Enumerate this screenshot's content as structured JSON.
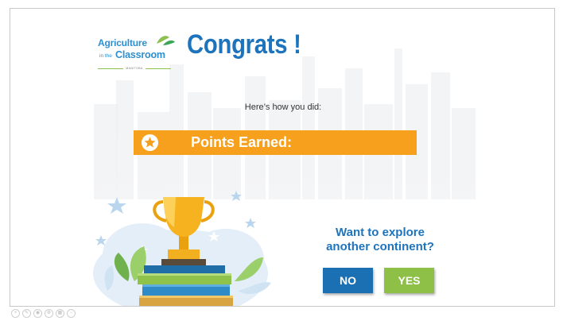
{
  "logo": {
    "line1": "Agriculture",
    "line2_prefix": "in the",
    "line2": "Classroom",
    "line3": "MANITOBA"
  },
  "title": "Congrats !",
  "subtitle": "Here’s how you did:",
  "banner": {
    "icon": "star-icon",
    "label": "Points Earned:"
  },
  "question": {
    "line1": "Want to explore",
    "line2": "another continent?"
  },
  "buttons": {
    "no": "NO",
    "yes": "YES"
  },
  "toolbar_icons": [
    "plus-icon",
    "edit-icon",
    "eye-icon",
    "settings-icon",
    "grid-icon",
    "minus-icon"
  ],
  "colors": {
    "title_blue": "#1d74bd",
    "banner_orange": "#f6a01d",
    "no_blue": "#1b6fb3",
    "yes_green": "#8ebf46"
  }
}
